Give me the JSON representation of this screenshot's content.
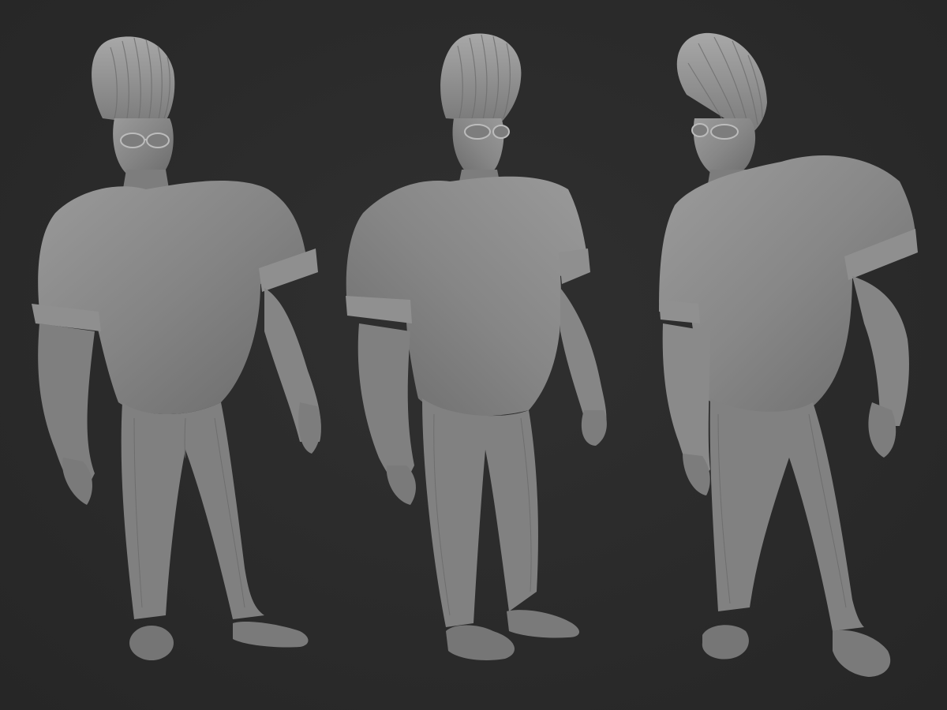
{
  "scene": {
    "background_color": "#2b2b2b",
    "clay_color": "#8a8a8a",
    "views": [
      {
        "view": "front-three-quarter-left"
      },
      {
        "view": "three-quarter-right"
      },
      {
        "view": "three-quarter-left-rear"
      }
    ]
  }
}
